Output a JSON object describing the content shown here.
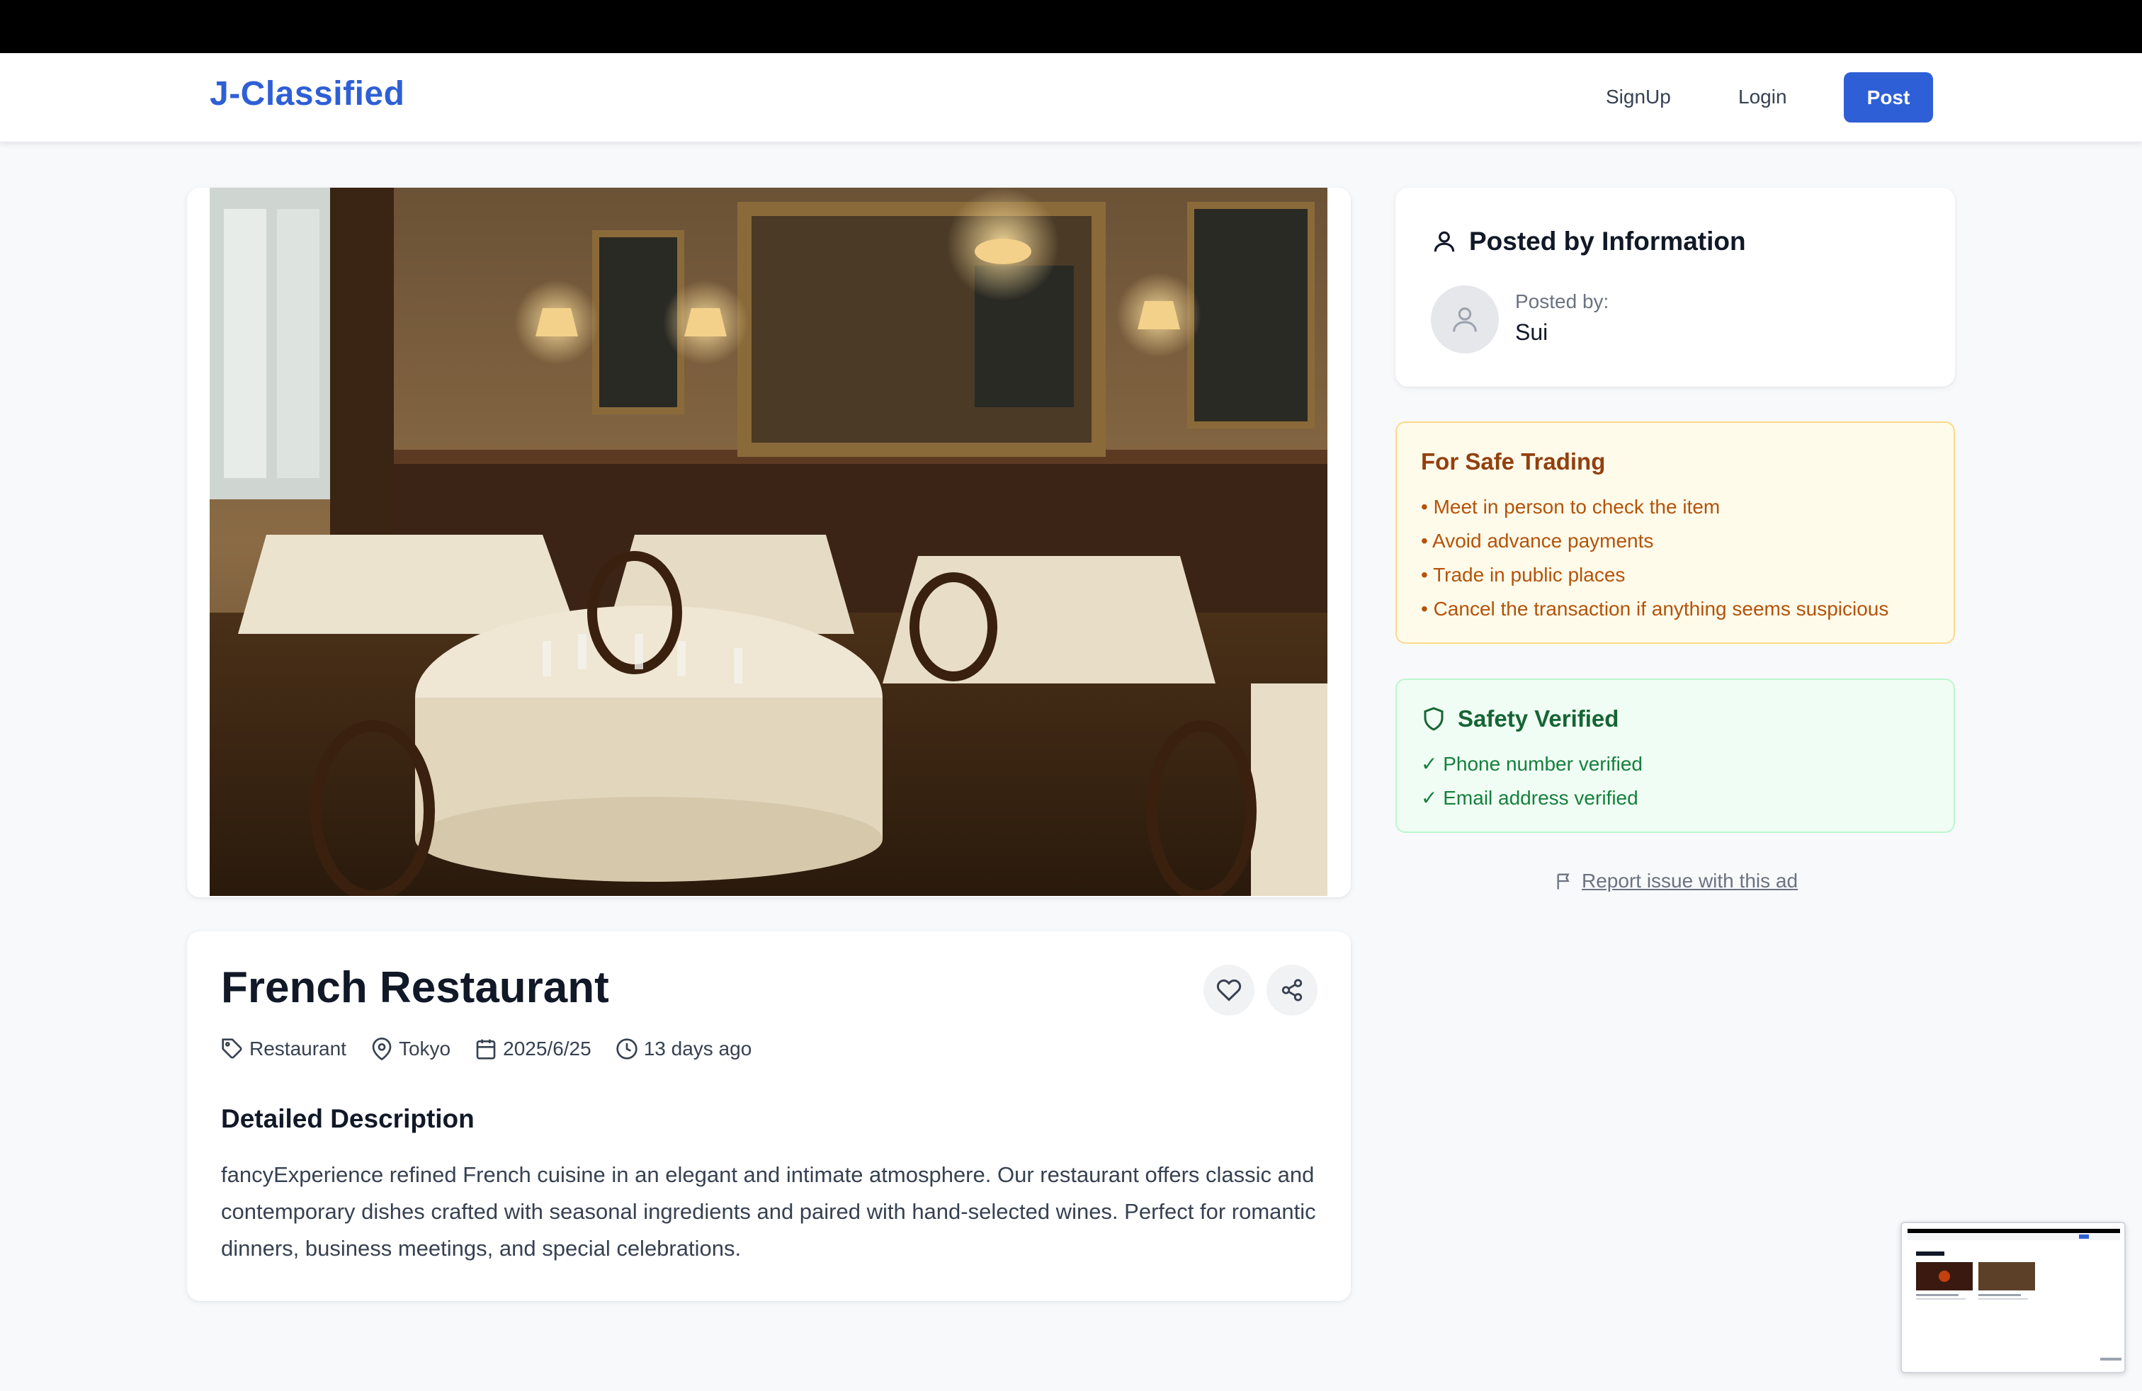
{
  "app": {
    "brand": "J-Classified"
  },
  "nav": {
    "signup_label": "SignUp",
    "login_label": "Login",
    "post_label": "Post"
  },
  "listing": {
    "title": "French Restaurant",
    "category": "Restaurant",
    "location": "Tokyo",
    "date": "2025/6/25",
    "posted_ago": "13 days ago",
    "description_heading": "Detailed Description",
    "description": "fancyExperience refined French cuisine in an elegant and intimate atmosphere. Our restaurant offers classic and contemporary dishes crafted with seasonal ingredients and paired with hand-selected wines. Perfect for romantic dinners, business meetings, and special celebrations.",
    "photo_icon": "restaurant-photo"
  },
  "poster": {
    "heading": "Posted by Information",
    "label": "Posted by:",
    "name": "Sui"
  },
  "safe_trading": {
    "heading": "For Safe Trading",
    "tips": [
      "• Meet in person to check the item",
      "• Avoid advance payments",
      "• Trade in public places",
      "• Cancel the transaction if anything seems suspicious"
    ]
  },
  "verification": {
    "heading": "Safety Verified",
    "items": [
      "✓ Phone number verified",
      "✓ Email address verified"
    ]
  },
  "report": {
    "label": "Report issue with this ad"
  },
  "colors": {
    "brand": "#2f5fd6",
    "warning_bg": "#fffbeb",
    "warning_text": "#b45309",
    "success_bg": "#f0fdf4",
    "success_text": "#15803d"
  }
}
